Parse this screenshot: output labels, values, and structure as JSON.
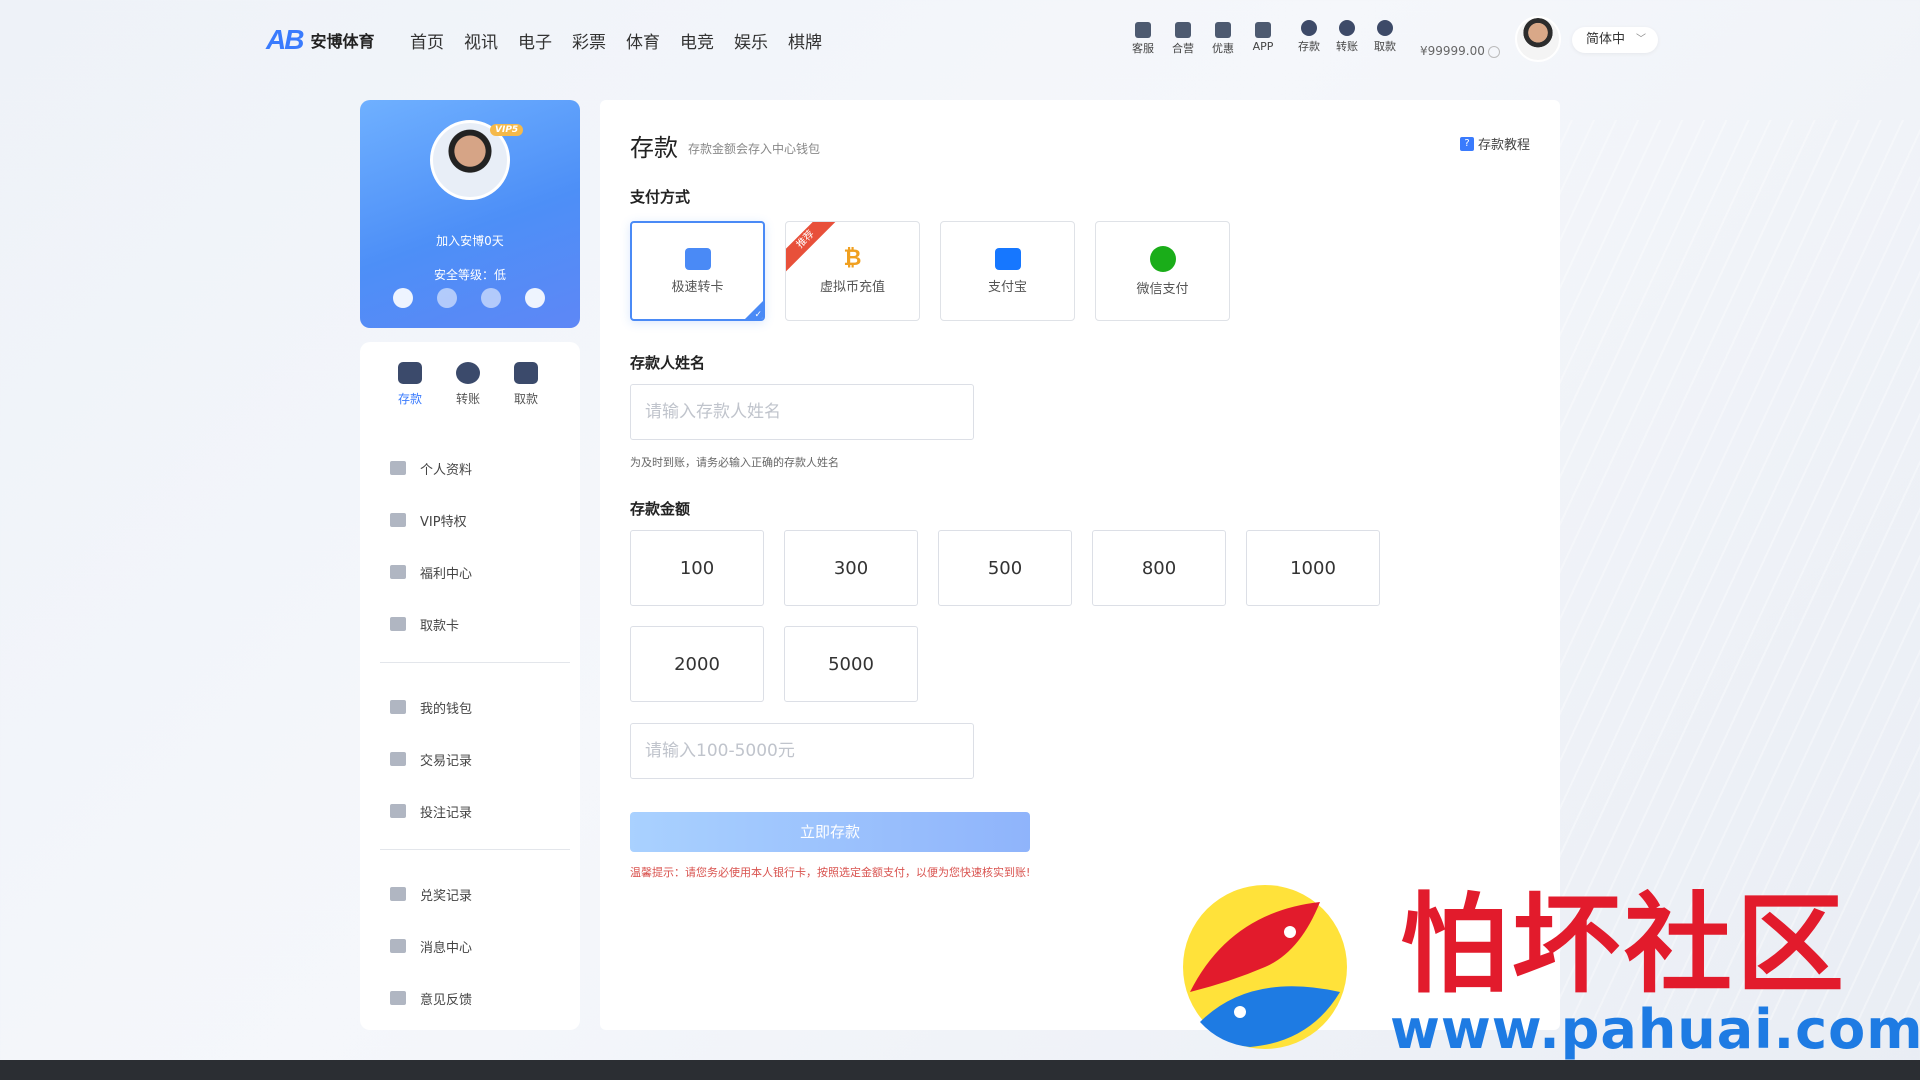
{
  "header": {
    "logo_mark": "AB",
    "brand": "安博体育",
    "nav": [
      "首页",
      "视讯",
      "电子",
      "彩票",
      "体育",
      "电竞",
      "娱乐",
      "棋牌"
    ],
    "tools": [
      "客服",
      "合营",
      "优惠",
      "APP"
    ],
    "wallet_tools": [
      "存款",
      "转账",
      "取款"
    ],
    "balance": "¥99999.00",
    "language": "简体中"
  },
  "profile": {
    "vip": "VIP5",
    "join_text": "加入安博0天",
    "security_text": "安全等级：低"
  },
  "sidebar": {
    "quick": [
      "存款",
      "转账",
      "取款"
    ],
    "group1": [
      "个人资料",
      "VIP特权",
      "福利中心",
      "取款卡"
    ],
    "group2": [
      "我的钱包",
      "交易记录",
      "投注记录"
    ],
    "group3": [
      "兑奖记录",
      "消息中心",
      "意见反馈"
    ]
  },
  "main": {
    "title": "存款",
    "subtitle": "存款金额会存入中心钱包",
    "tutorial": "存款教程",
    "pay_label": "支付方式",
    "pay_methods": [
      "极速转卡",
      "虚拟币充值",
      "支付宝",
      "微信支付"
    ],
    "recommend": "推荐",
    "name_label": "存款人姓名",
    "name_placeholder": "请输入存款人姓名",
    "name_hint": "为及时到账，请务必输入正确的存款人姓名",
    "amount_label": "存款金额",
    "amounts": [
      "100",
      "300",
      "500",
      "800",
      "1000",
      "2000",
      "5000"
    ],
    "amount_placeholder": "请输入100-5000元",
    "submit": "立即存款",
    "tip": "温馨提示：请您务必使用本人银行卡，按照选定金额支付，以便为您快速核实到账!"
  },
  "watermark": {
    "text": "怕坏社区",
    "url": "www.pahuai.com"
  },
  "colors": {
    "accent": "#3a7bfd",
    "profile_gradient_start": "#6fb0ff",
    "tip": "#d9534f",
    "watermark_red": "#e21b2c",
    "watermark_blue": "#1e7be3"
  }
}
